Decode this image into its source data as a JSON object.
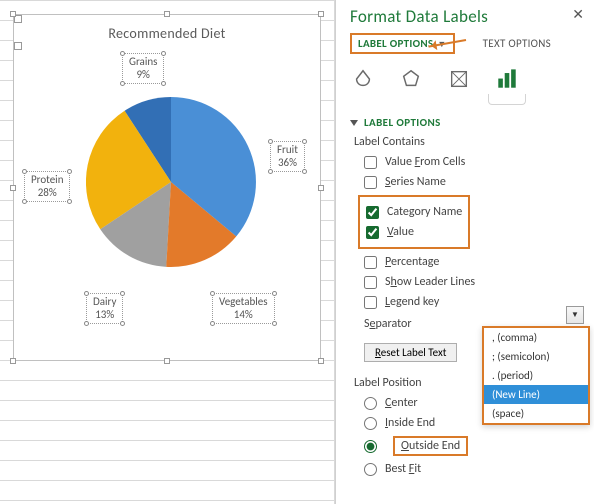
{
  "chart": {
    "title": "Recommended Diet",
    "labels": [
      {
        "name": "Grains",
        "value": "9%"
      },
      {
        "name": "Fruit",
        "value": "36%"
      },
      {
        "name": "Vegetables",
        "value": "14%"
      },
      {
        "name": "Dairy",
        "value": "13%"
      },
      {
        "name": "Protein",
        "value": "28%"
      }
    ]
  },
  "chart_data": {
    "type": "pie",
    "title": "Recommended Diet",
    "categories": [
      "Grains",
      "Fruit",
      "Vegetables",
      "Dairy",
      "Protein"
    ],
    "values": [
      9,
      36,
      14,
      13,
      28
    ],
    "colors": [
      "#326fb5",
      "#4a8fd6",
      "#e37a2a",
      "#a0a0a0",
      "#f2b20d"
    ]
  },
  "pane": {
    "title": "Format Data Labels",
    "close": "✕",
    "tabs": {
      "label_options": "LABEL OPTIONS",
      "text_options": "TEXT OPTIONS"
    },
    "section": "LABEL OPTIONS",
    "label_contains": "Label Contains",
    "opts": {
      "value_from_cells": "Value From Cells",
      "series_name": "Series Name",
      "category_name": "Category Name",
      "value": "Value",
      "percentage": "Percentage",
      "show_leader": "Show Leader Lines",
      "legend_key": "Legend key"
    },
    "separator": "Separator",
    "reset": "Reset Label Text",
    "label_position": "Label Position",
    "positions": {
      "center": "Center",
      "inside_end": "Inside End",
      "outside_end": "Outside End",
      "best_fit": "Best Fit"
    },
    "dropdown": {
      "comma": ", (comma)",
      "semicolon": "; (semicolon)",
      "period": ". (period)",
      "newline": "(New Line)",
      "space": "  (space)"
    }
  }
}
